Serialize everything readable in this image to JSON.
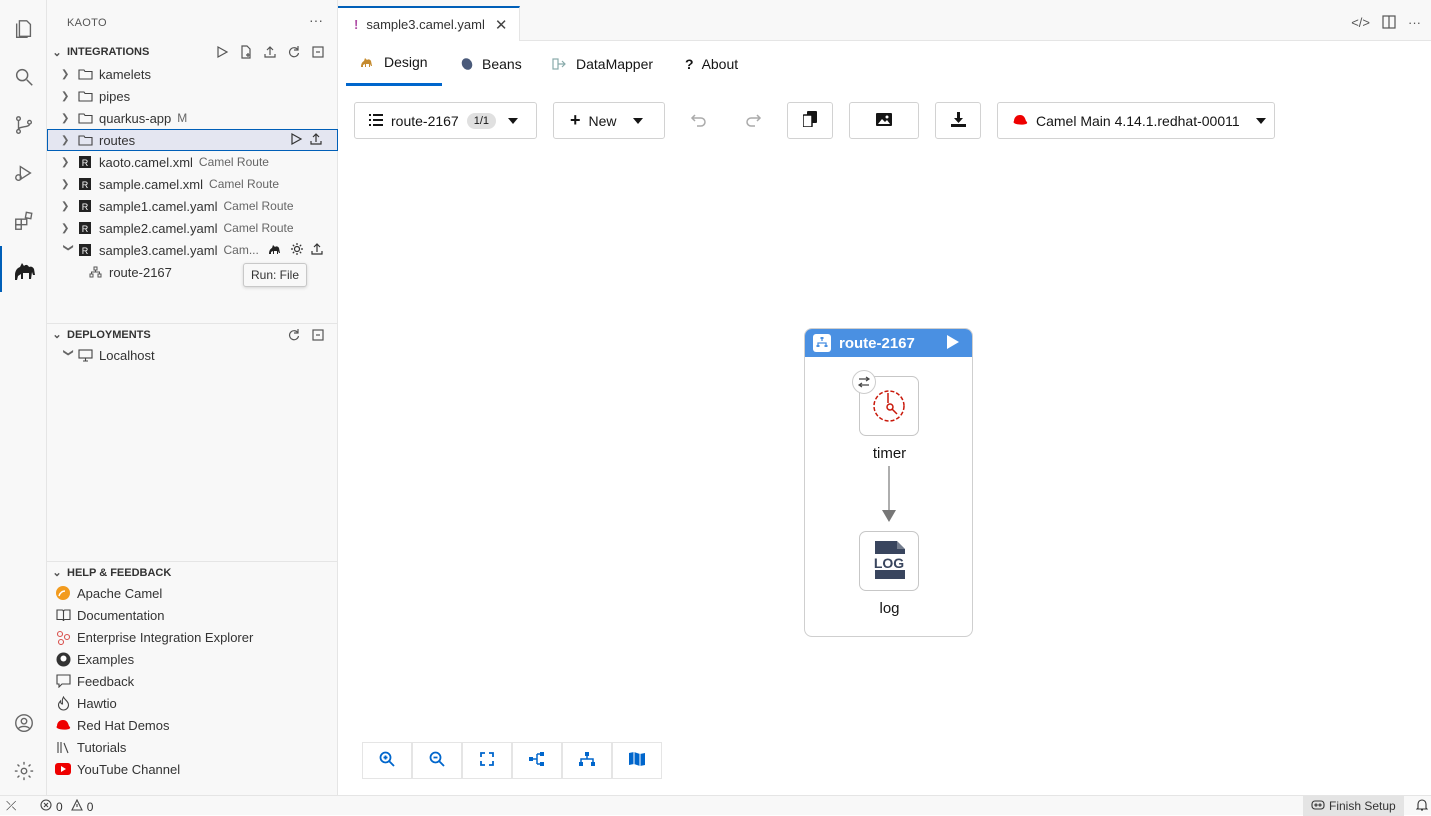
{
  "explorer": {
    "title": "KAOTO"
  },
  "integrations": {
    "header": "INTEGRATIONS",
    "items": [
      {
        "label": "kamelets",
        "kind": "folder",
        "desc": ""
      },
      {
        "label": "pipes",
        "kind": "folder",
        "desc": ""
      },
      {
        "label": "quarkus-app",
        "kind": "folder",
        "desc": "M"
      },
      {
        "label": "routes",
        "kind": "folder",
        "desc": ""
      },
      {
        "label": "kaoto.camel.xml",
        "kind": "route",
        "desc": "Camel Route"
      },
      {
        "label": "sample.camel.xml",
        "kind": "route",
        "desc": "Camel Route"
      },
      {
        "label": "sample1.camel.yaml",
        "kind": "route",
        "desc": "Camel Route"
      },
      {
        "label": "sample2.camel.yaml",
        "kind": "route",
        "desc": "Camel Route"
      },
      {
        "label": "sample3.camel.yaml",
        "kind": "route",
        "desc": "Cam..."
      }
    ],
    "child": "route-2167",
    "tooltip": "Run: File"
  },
  "deployments": {
    "header": "DEPLOYMENTS",
    "host": "Localhost"
  },
  "help": {
    "header": "HELP & FEEDBACK",
    "items": [
      "Apache Camel",
      "Documentation",
      "Enterprise Integration Explorer",
      "Examples",
      "Feedback",
      "Hawtio",
      "Red Hat Demos",
      "Tutorials",
      "YouTube Channel"
    ]
  },
  "editor": {
    "tab_label": "sample3.camel.yaml",
    "tab_marker": "!",
    "subtabs": [
      "Design",
      "Beans",
      "DataMapper",
      "About"
    ],
    "route_select": "route-2167",
    "route_count": "1/1",
    "new_label": "New",
    "runtime": "Camel Main 4.14.1.redhat-00011"
  },
  "canvas": {
    "route_name": "route-2167",
    "nodes": [
      {
        "label": "timer"
      },
      {
        "label": "log"
      }
    ],
    "log_icon_text": "LOG"
  },
  "status": {
    "errors": "0",
    "warnings": "0",
    "finish": "Finish Setup"
  },
  "colors": {
    "accent": "#005fb8",
    "route_header": "#4a90e2",
    "timer": "#c9190b"
  }
}
